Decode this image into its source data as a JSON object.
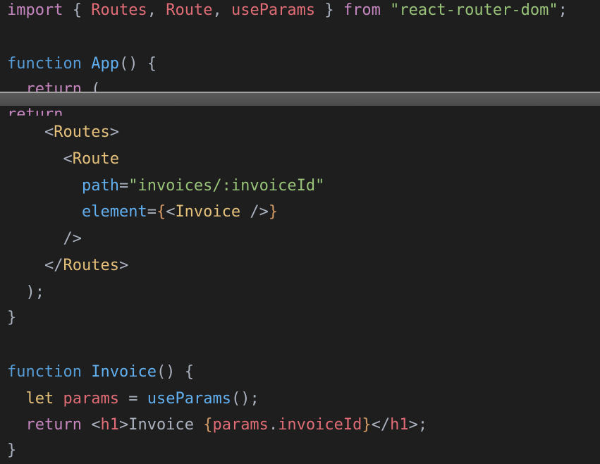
{
  "code": {
    "import_kw": "import",
    "import_open": "{",
    "import_names": [
      "Routes",
      "Route",
      "useParams"
    ],
    "import_close": "}",
    "from_kw": "from",
    "module": "\"react-router-dom\"",
    "semicolon": ";",
    "function_kw": "function",
    "app_name": "App",
    "parens": "()",
    "open_brace": "{",
    "close_brace": "}",
    "return_kw": "return",
    "return_paren": "(",
    "routes_tag": "Routes",
    "route_tag": "Route",
    "path_attr": "path",
    "path_value": "\"invoices/:invoiceId\"",
    "element_attr": "element",
    "invoice_component": "Invoice",
    "self_close": "/>",
    "close_paren": ");",
    "invoice_name": "Invoice",
    "let_kw": "let",
    "params_var": "params",
    "use_params_call": "useParams",
    "h1_tag": "h1",
    "h1_text": "Invoice ",
    "params_expr_obj": "params",
    "params_expr_prop": "invoiceId"
  },
  "colors": {
    "background": "#1e1e1e",
    "keyword": "#c586c0",
    "function_name": "#61afef",
    "variable": "#e06c75",
    "string": "#98c379",
    "tag": "#e5c07b",
    "brace": "#d19a66"
  }
}
